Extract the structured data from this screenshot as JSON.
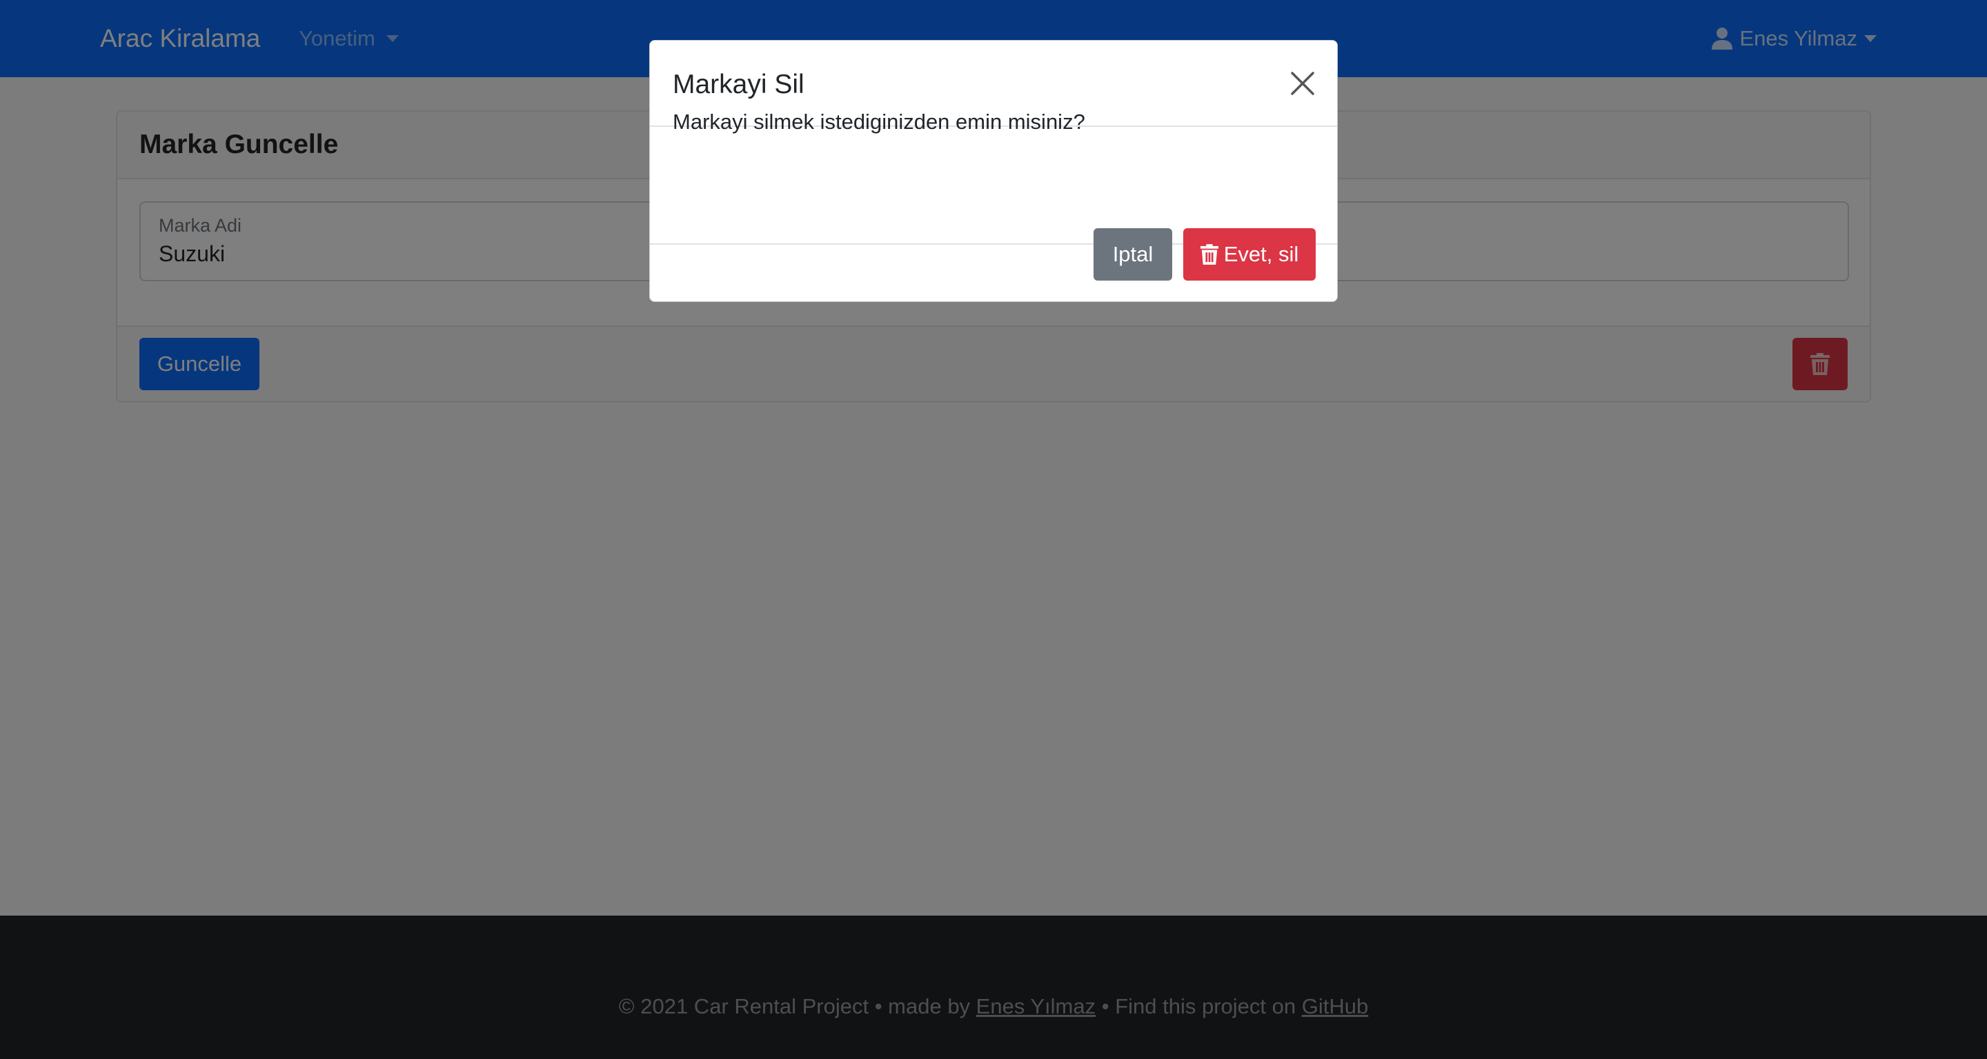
{
  "navbar": {
    "brand": "Arac Kiralama",
    "menu_label": "Yonetim",
    "user_name": "Enes Yilmaz",
    "icons": {
      "user": "user-icon",
      "menu_caret": "chevron-down-icon"
    }
  },
  "card": {
    "title": "Marka Guncelle",
    "field_label": "Marka Adi",
    "field_value": "Suzuki",
    "update_label": "Guncelle",
    "delete_icon": "trash-icon"
  },
  "modal": {
    "title": "Markayi Sil",
    "message": "Markayi silmek istediginizden emin misiniz?",
    "cancel_label": "Iptal",
    "confirm_label": "Evet, sil",
    "close_icon": "close-icon",
    "confirm_icon": "trash-icon"
  },
  "footer": {
    "prefix": "© 2021 Car Rental Project • made by ",
    "author_link": "Enes Yılmaz",
    "middle": " • Find this project on ",
    "repo_link": "GitHub"
  },
  "colors": {
    "primary": "#0d6efd",
    "danger": "#dc3545",
    "secondary": "#6c757d",
    "dark": "#212529"
  }
}
